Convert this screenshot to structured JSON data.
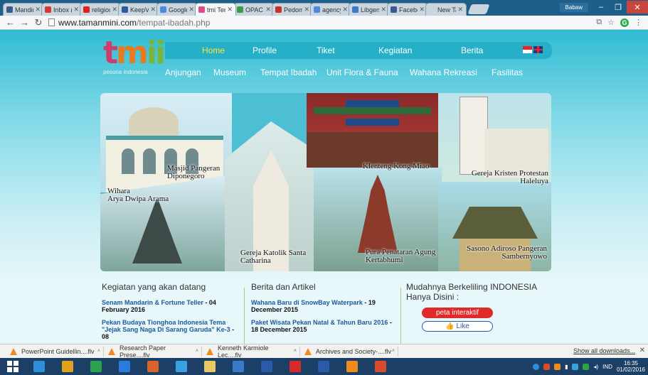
{
  "browser": {
    "tabs": [
      {
        "title": "Mandiri",
        "color": "#3a5c8a",
        "active": false
      },
      {
        "title": "Inbox (",
        "color": "#d23a2f",
        "active": false
      },
      {
        "title": "religiou",
        "color": "#e02020",
        "active": false
      },
      {
        "title": "KeepVi",
        "color": "#2a5c9a",
        "active": false
      },
      {
        "title": "Google",
        "color": "#4a8ae0",
        "active": false
      },
      {
        "title": "tmi Tempat",
        "color": "#e04a8a",
        "active": true
      },
      {
        "title": "OPAC -",
        "color": "#3a9a4a",
        "active": false
      },
      {
        "title": "Pedom",
        "color": "#c8302a",
        "active": false
      },
      {
        "title": "agency",
        "color": "#4a8ae0",
        "active": false
      },
      {
        "title": "Libgen",
        "color": "#3a7ac8",
        "active": false
      },
      {
        "title": "Faceboo",
        "color": "#3b5998",
        "active": false
      },
      {
        "title": "New Tab",
        "color": "#c9d6df",
        "active": false
      }
    ],
    "profile_name": "Babaw",
    "url_host": "www.tamanmini.com",
    "url_path": "/tempat-ibadah.php"
  },
  "site": {
    "logo_text": [
      "t",
      "m",
      "ii"
    ],
    "logo_tagline": "pesona indonesia",
    "top_nav": [
      {
        "label": "Home",
        "active": true
      },
      {
        "label": "Profile",
        "active": false
      },
      {
        "label": "Tiket",
        "active": false
      },
      {
        "label": "Kegiatan",
        "active": false
      },
      {
        "label": "Berita",
        "active": false
      }
    ],
    "sub_nav": [
      "Anjungan",
      "Museum",
      "Tempat Ibadah",
      "Unit Flora & Fauna",
      "Wahana Rekreasi",
      "Fasilitas"
    ],
    "places": [
      {
        "name": "Masjid Pangeran\nDiponegoro"
      },
      {
        "name": "Wihara\nArya Dwipa Arama"
      },
      {
        "name": "Klenteng Kong Miao"
      },
      {
        "name": "Gereja Kristen Protestan\nHaleluya"
      },
      {
        "name": "Gereja Katolik Santa\nCatharina"
      },
      {
        "name": "Pura Penataran Agung\nKertabhumi"
      },
      {
        "name": "Sasono Adiroso Pangeran\nSambernyowo"
      }
    ],
    "events": {
      "heading": "Kegiatan yang akan datang",
      "items": [
        {
          "title": "Senam Mandarin & Fortune Teller",
          "date": " - 04 February 2016"
        },
        {
          "title": "Pekan Budaya Tionghoa Indonesia Tema \"Jejak Sang Naga Di Sarang Garuda\" Ke-3",
          "date": " - 08"
        }
      ]
    },
    "news": {
      "heading": "Berita dan Artikel",
      "items": [
        {
          "title": "Wahana Baru di SnowBay Waterpark",
          "date": " - 19 December 2015"
        },
        {
          "title": "Paket Wisata Pekan Natal & Tahun Baru 2016",
          "date": " - 18 December 2015"
        }
      ]
    },
    "promo": {
      "heading": "Mudahnya Berkeliling INDONESIA Hanya Disini :",
      "map_button": "peta interaktif",
      "like_button": "Like"
    }
  },
  "downloads": {
    "items": [
      "PowerPoint Guidellin....flv",
      "Research Paper Prese....flv",
      "Kenneth Karmiole Lec....flv",
      "Archives and Society-....flv"
    ],
    "show_all": "Show all downloads..."
  },
  "taskbar": {
    "apps": [
      {
        "name": "ie",
        "color": "#2e8fd8"
      },
      {
        "name": "chrome",
        "color": "#e0a020"
      },
      {
        "name": "store",
        "color": "#2aa34a"
      },
      {
        "name": "dropbox",
        "color": "#2a7ae0"
      },
      {
        "name": "paint",
        "color": "#d8642a"
      },
      {
        "name": "media",
        "color": "#3aa0e0"
      },
      {
        "name": "explorer",
        "color": "#e8c860"
      },
      {
        "name": "network",
        "color": "#3a7ac8"
      },
      {
        "name": "player",
        "color": "#2a5aa8"
      },
      {
        "name": "acrobat",
        "color": "#d82a2a"
      },
      {
        "name": "word",
        "color": "#2a5aa8"
      },
      {
        "name": "vlc",
        "color": "#f08a1c"
      },
      {
        "name": "powerpoint",
        "color": "#d84a2a"
      }
    ],
    "lang": "IND",
    "time": "16:35",
    "date": "01/02/2016"
  }
}
